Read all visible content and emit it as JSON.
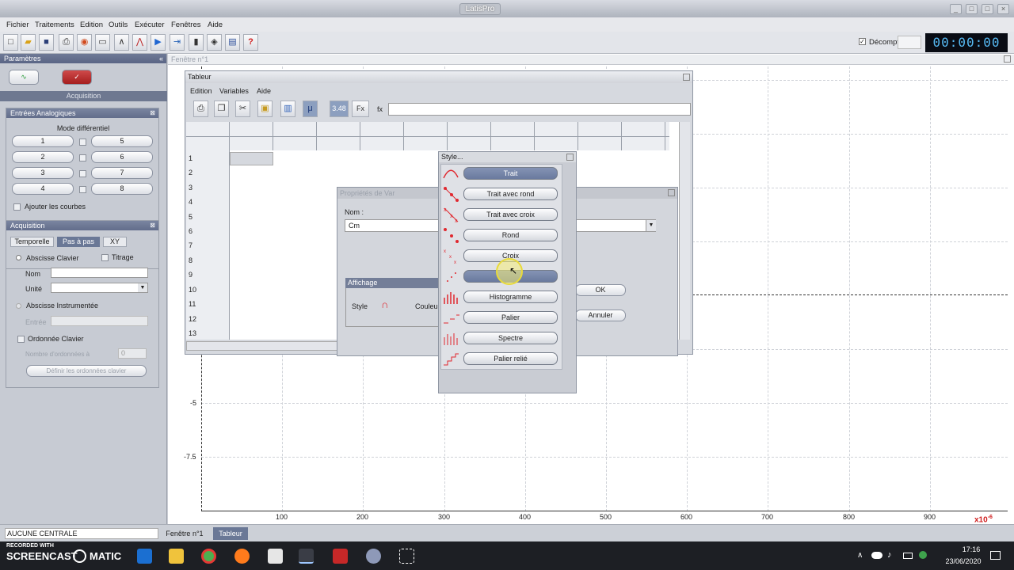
{
  "app": {
    "title": "LatisPro"
  },
  "menu": [
    "Fichier",
    "Traitements",
    "Edition",
    "Outils",
    "Exécuter",
    "Fenêtres",
    "Aide"
  ],
  "toolbar": {
    "countdown_label": "Décompte",
    "timer": "00:00:00"
  },
  "params": {
    "title": "Paramètres",
    "acquisition_tab": "Acquisition"
  },
  "analog": {
    "title": "Entrées Analogiques",
    "mode": "Mode différentiel",
    "channels": [
      "1",
      "2",
      "3",
      "4",
      "5",
      "6",
      "7",
      "8"
    ],
    "add_curves": "Ajouter les courbes"
  },
  "acq": {
    "title": "Acquisition",
    "tabs": [
      "Temporelle",
      "Pas à pas",
      "XY"
    ],
    "abscisse_clavier": "Abscisse Clavier",
    "titrage": "Titrage",
    "nom": "Nom",
    "unite": "Unité",
    "abscisse_instr": "Abscisse Instrumentée",
    "entree": "Entrée",
    "ordonnee": "Ordonnée Clavier",
    "nb_ordonnees": "Nombre d'ordonnées à",
    "nb_value": "0",
    "define_btn": "Définir les ordonnées clavier"
  },
  "window1": {
    "title": "Fenêtre n°1"
  },
  "plot": {
    "x_ticks": [
      "100",
      "200",
      "300",
      "400",
      "500",
      "600",
      "700",
      "800",
      "900"
    ],
    "y_ticks": [
      "-5",
      "-7.5"
    ],
    "x_unit": "x10",
    "x_exp": "-6"
  },
  "tableur": {
    "title": "Tableur",
    "menu": [
      "Edition",
      "Variables",
      "Aide"
    ],
    "num_format": "3.48",
    "fx_btn": "Fx",
    "fx_label": "fx",
    "rows": [
      "1",
      "2",
      "3",
      "4",
      "5",
      "6",
      "7",
      "8",
      "9",
      "10",
      "11",
      "12",
      "13"
    ]
  },
  "prop": {
    "title": "Propriétés de Var",
    "nom_label": "Nom :",
    "nom_value": "Cm",
    "affichage": "Affichage",
    "style_label": "Style",
    "couleur_label": "Couleu",
    "ok": "OK",
    "annuler": "Annuler"
  },
  "style": {
    "title": "Style...",
    "options": [
      "Trait",
      "Trait avec rond",
      "Trait avec croix",
      "Rond",
      "Croix",
      "",
      "Histogramme",
      "Palier",
      "Spectre",
      "Palier relié"
    ]
  },
  "status": {
    "central": "AUCUNE CENTRALE",
    "tabs": [
      "Fenêtre n°1",
      "Tableur"
    ]
  },
  "taskbar": {
    "recorded": "RECORDED WITH",
    "brand": "SCREENCAST",
    "brand2": "MATIC",
    "time": "17:16",
    "date": "23/06/2020"
  },
  "colors": {
    "accent": "#56b9f2",
    "style_red": "#e0282f",
    "header": "#5f6a8a"
  }
}
